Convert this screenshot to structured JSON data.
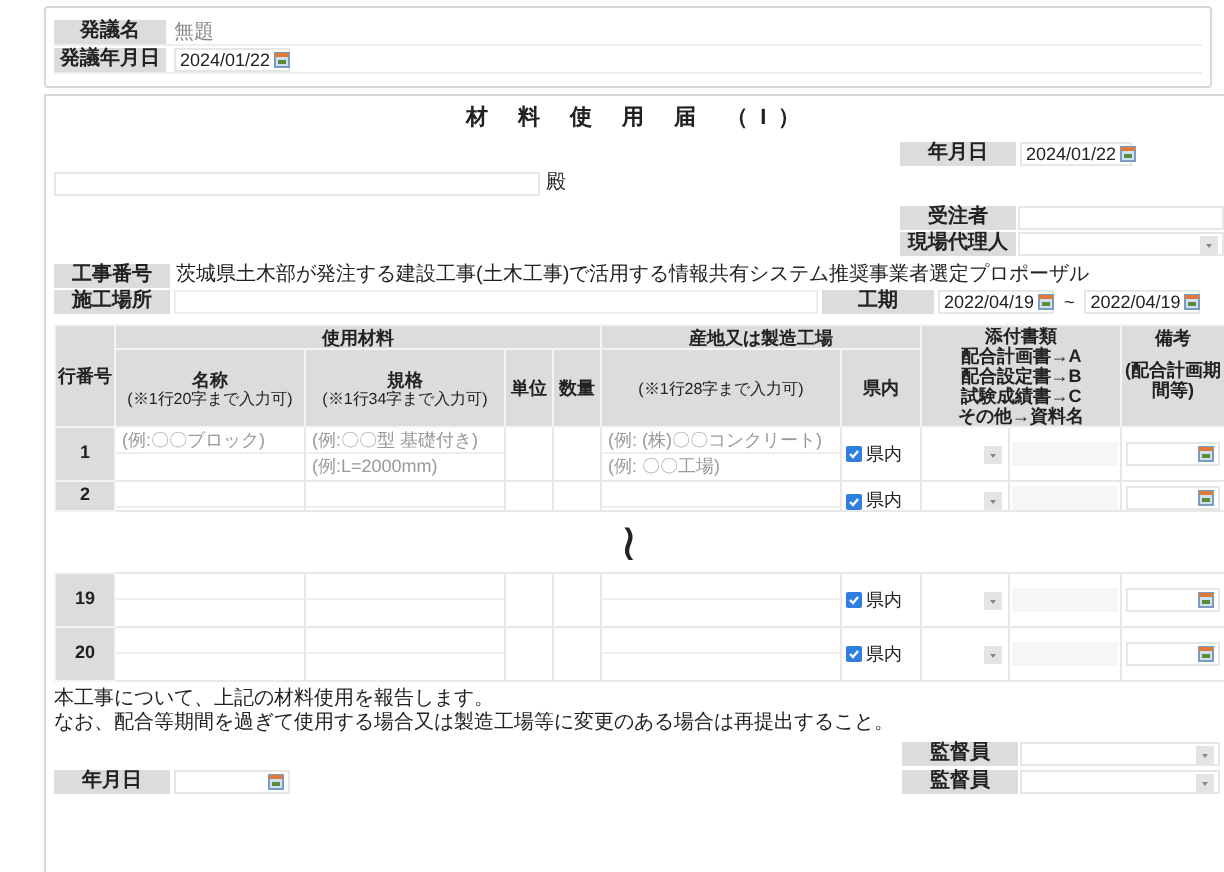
{
  "header_card": {
    "fields": [
      {
        "label": "発議名",
        "placeholder": "無題",
        "kind": "text"
      },
      {
        "label": "発議年月日",
        "value": "2024/01/22",
        "kind": "date"
      }
    ]
  },
  "form": {
    "title": "材 料 使 用 届 （I）",
    "addressee_suffix": "殿",
    "date": {
      "label": "年月日",
      "value": "2024/01/22"
    },
    "contractor": {
      "label": "受注者"
    },
    "site_agent": {
      "label": "現場代理人"
    },
    "project_number": {
      "label": "工事番号",
      "value": "茨城県土木部が発注する建設工事(土木工事)で活用する情報共有システム推奨事業者選定プロポーザル"
    },
    "site": {
      "label": "施工場所"
    },
    "period": {
      "label": "工期",
      "start": "2022/04/19",
      "separator": "~",
      "end": "2022/04/19"
    },
    "table": {
      "headers": {
        "row_number": "行番号",
        "materials": "使用材料",
        "name": "名称",
        "name_note": "(※1行20字まで入力可)",
        "spec": "規格",
        "spec_note": "(※1行34字まで入力可)",
        "unit": "単位",
        "quantity": "数量",
        "origin": "産地又は製造工場",
        "origin_note": "(※1行28字まで入力可)",
        "in_prefecture": "県内",
        "attachments": "添付書類",
        "attachments_lines": [
          "配合計画書→A",
          "配合設定書→B",
          "試験成績書→C",
          "その他→資料名"
        ],
        "remarks": "備考",
        "remarks_note": "(配合計画期間等)"
      },
      "rows_top": [
        {
          "number": "1",
          "name_placeholders": [
            "(例:〇〇ブロック)"
          ],
          "spec_placeholders": [
            "(例:〇〇型 基礎付き)",
            "(例:L=2000mm)"
          ],
          "origin_placeholders": [
            "(例: (株)〇〇コンクリート)",
            "(例: 〇〇工場)"
          ],
          "in_prefecture": true,
          "in_prefecture_label": "県内"
        },
        {
          "number": "2",
          "in_prefecture": true,
          "in_prefecture_label": "県内"
        }
      ],
      "break_mark": "≀",
      "rows_bottom": [
        {
          "number": "19",
          "in_prefecture": true,
          "in_prefecture_label": "県内"
        },
        {
          "number": "20",
          "in_prefecture": true,
          "in_prefecture_label": "県内"
        }
      ]
    },
    "notes": [
      "本工事について、上記の材料使用を報告します。",
      "なお、配合等期間を過ぎて使用する場合又は製造工場等に変更のある場合は再提出すること。"
    ],
    "footer_date": {
      "label": "年月日"
    },
    "supervisors": [
      {
        "label": "監督員"
      },
      {
        "label": "監督員"
      }
    ]
  }
}
